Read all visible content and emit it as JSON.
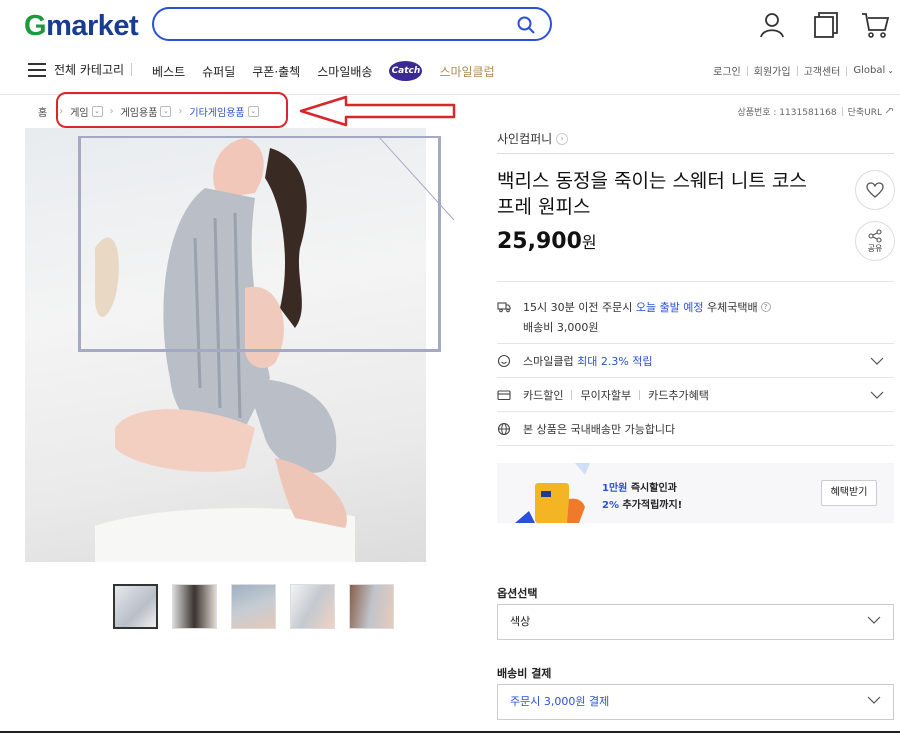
{
  "header": {
    "logo_g": "G",
    "logo_rest": "market",
    "search_placeholder": "",
    "all_categories": "전체 카테고리",
    "nav": [
      "베스트",
      "슈퍼딜",
      "쿠폰·출첵",
      "스마일배송"
    ],
    "catch_label": "Catch",
    "smile_club": "스마일클럽",
    "util": [
      "로그인",
      "회원가입",
      "고객센터",
      "Global"
    ],
    "colors": {
      "brand_green": "#1d9a3d",
      "brand_blue": "#183c91",
      "search_border": "#2b51d8"
    }
  },
  "breadcrumb": {
    "home": "홈",
    "level1": "게임",
    "level2": "게임용품",
    "level3": "기타게임용품",
    "product_no": "상품번호 : 1131581168",
    "short_url": "단축URL"
  },
  "product": {
    "seller": "사인컴퍼니",
    "title": "백리스 동정을 죽이는 스웨터 니트 코스프레 원피스",
    "price": "25,900",
    "price_unit": "원",
    "share_label": "공유"
  },
  "shipping": {
    "text1": "15시 30분 이전 주문시",
    "text_blue": "오늘 출발 예정",
    "text2": "우체국택배",
    "fee": "배송비 3,000원"
  },
  "smile_club_row": {
    "label": "스마일클럽",
    "blue": "최대 2.3% 적립"
  },
  "card_row": [
    "카드할인",
    "무이자할부",
    "카드추가혜택"
  ],
  "domestic_row": "본 상품은 국내배송만 가능합니다",
  "banner": {
    "line1_blue": "1만원",
    "line1": " 즉시할인과",
    "line2_blue": "2%",
    "line2": " 추가적립까지!",
    "button": "혜택받기"
  },
  "options": {
    "label": "옵션선택",
    "select_value": "색상"
  },
  "shipping_pay": {
    "label": "배송비 결제",
    "select_value": "주문시 3,000원 결제"
  }
}
